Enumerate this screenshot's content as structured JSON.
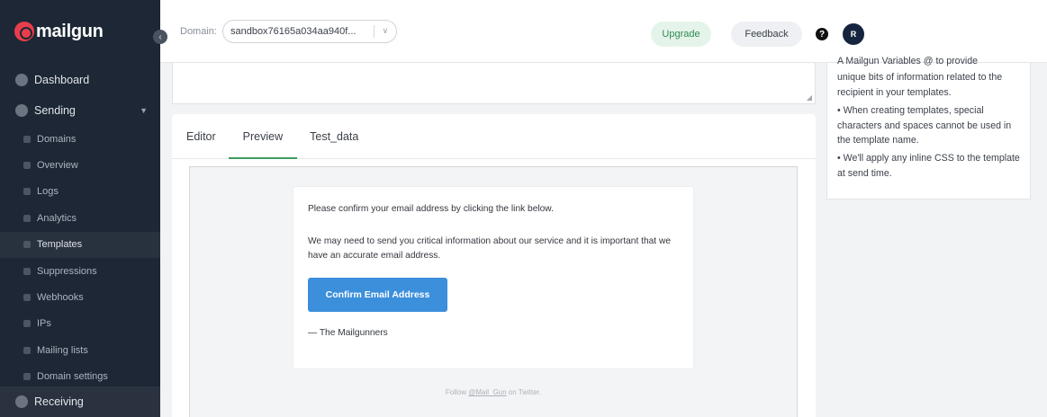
{
  "sidebar": {
    "logo": "mailgun",
    "nav": [
      {
        "label": "Dashboard"
      },
      {
        "label": "Sending"
      }
    ],
    "sending_items": [
      {
        "label": "Domains"
      },
      {
        "label": "Overview"
      },
      {
        "label": "Logs"
      },
      {
        "label": "Analytics"
      },
      {
        "label": "Templates"
      },
      {
        "label": "Suppressions"
      },
      {
        "label": "Webhooks"
      },
      {
        "label": "IPs"
      },
      {
        "label": "Mailing lists"
      },
      {
        "label": "Domain settings"
      }
    ],
    "receiving": "Receiving"
  },
  "topbar": {
    "domain_label": "Domain:",
    "domain_value": "sandbox76165a034aa940f...",
    "upgrade": "Upgrade",
    "feedback": "Feedback",
    "help": "?",
    "avatar": "R"
  },
  "tabs": [
    {
      "label": "Editor"
    },
    {
      "label": "Preview"
    },
    {
      "label": "Test_data"
    }
  ],
  "email": {
    "line1": "Please confirm your email address by clicking the link below.",
    "line2": "We may need to send you critical information about our service and it is important that we have an accurate email address.",
    "button": "Confirm Email Address",
    "signature": "— The Mailgunners",
    "footer_prefix": "Follow ",
    "footer_link": "@Mail_Gun",
    "footer_suffix": " on Twitter."
  },
  "help_panel": {
    "top_cut": "A Mailgun Variables @ to provide",
    "p1": "unique bits of information related to the recipient in your templates.",
    "p2": "•  When creating templates, special characters and spaces cannot be used in the template name.",
    "p3": "•  We'll apply any inline CSS to the template at send time."
  },
  "colors": {
    "sidebar_bg": "#1d2735",
    "accent_green": "#3d9a5e",
    "button_blue": "#3b8fdb",
    "logo_red": "#e83e4b"
  }
}
